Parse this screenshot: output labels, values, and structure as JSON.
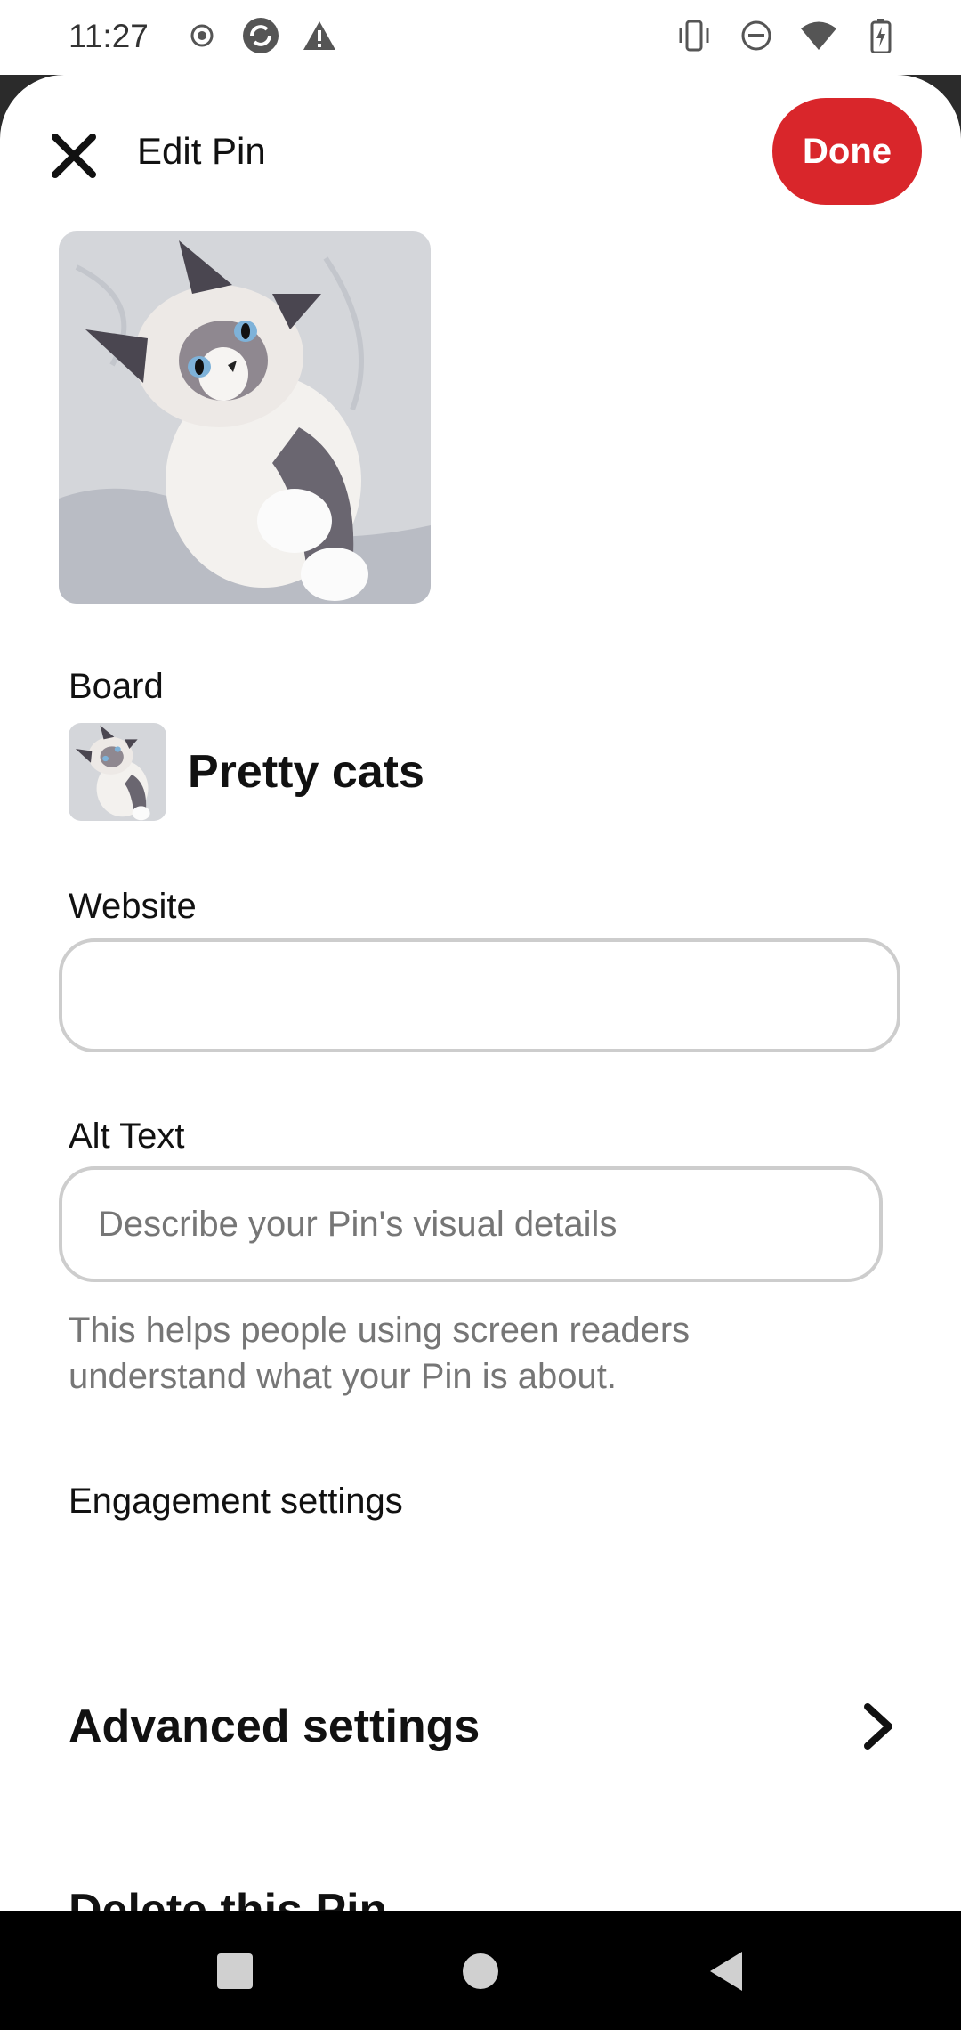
{
  "status_bar": {
    "time": "11:27",
    "left_icons": [
      "record-icon",
      "sync-icon",
      "warning-icon"
    ],
    "right_icons": [
      "vibrate-icon",
      "do-not-disturb-icon",
      "wifi-icon",
      "battery-charging-icon"
    ]
  },
  "header": {
    "title": "Edit Pin",
    "done_label": "Done",
    "accent_color": "#d9262b"
  },
  "board": {
    "label": "Board",
    "name": "Pretty cats"
  },
  "website": {
    "label": "Website",
    "value": "",
    "placeholder": ""
  },
  "alt_text": {
    "label": "Alt Text",
    "value": "",
    "placeholder": "Describe your Pin's visual details",
    "help": "This helps people using screen readers understand what your Pin is about."
  },
  "engagement": {
    "label": "Engagement settings"
  },
  "advanced": {
    "label": "Advanced settings"
  },
  "delete": {
    "label": "Delete this Pin"
  },
  "nav": {
    "icons": [
      "recents-square-icon",
      "home-circle-icon",
      "back-triangle-icon"
    ]
  }
}
